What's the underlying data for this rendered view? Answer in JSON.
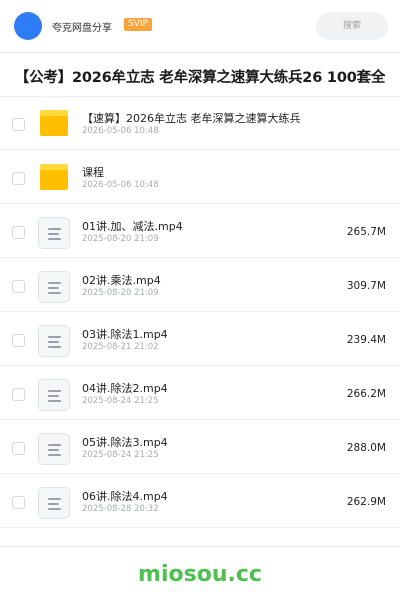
{
  "header": {
    "username": "夸克网盘分享",
    "badge": "SVIP",
    "search_label": "搜索"
  },
  "share_title": "【公考】2026牟立志 老牟深算之速算大练兵26 100套全",
  "files": [
    {
      "type": "folder",
      "name": "【速算】2026牟立志 老牟深算之速算大练兵",
      "date": "2026-05-06 10:48",
      "size": ""
    },
    {
      "type": "folder",
      "name": "课程",
      "date": "2026-05-06 10:48",
      "size": ""
    },
    {
      "type": "file",
      "name": "01讲.加、减法.mp4",
      "date": "2025-08-20 21:09",
      "size": "265.7M"
    },
    {
      "type": "file",
      "name": "02讲.乘法.mp4",
      "date": "2025-08-20 21:09",
      "size": "309.7M"
    },
    {
      "type": "file",
      "name": "03讲.除法1.mp4",
      "date": "2025-08-21 21:02",
      "size": "239.4M"
    },
    {
      "type": "file",
      "name": "04讲.除法2.mp4",
      "date": "2025-08-24 21:25",
      "size": "266.2M"
    },
    {
      "type": "file",
      "name": "05讲.除法3.mp4",
      "date": "2025-08-24 21:25",
      "size": "288.0M"
    },
    {
      "type": "file",
      "name": "06讲.除法4.mp4",
      "date": "2025-08-28 20:32",
      "size": "262.9M"
    }
  ],
  "watermark": "miosou.cc",
  "colors": {
    "avatar": "#2f7df6",
    "badge": "#f7a33b",
    "folder": "#ffbf00",
    "watermark": "#4fbf4f"
  }
}
